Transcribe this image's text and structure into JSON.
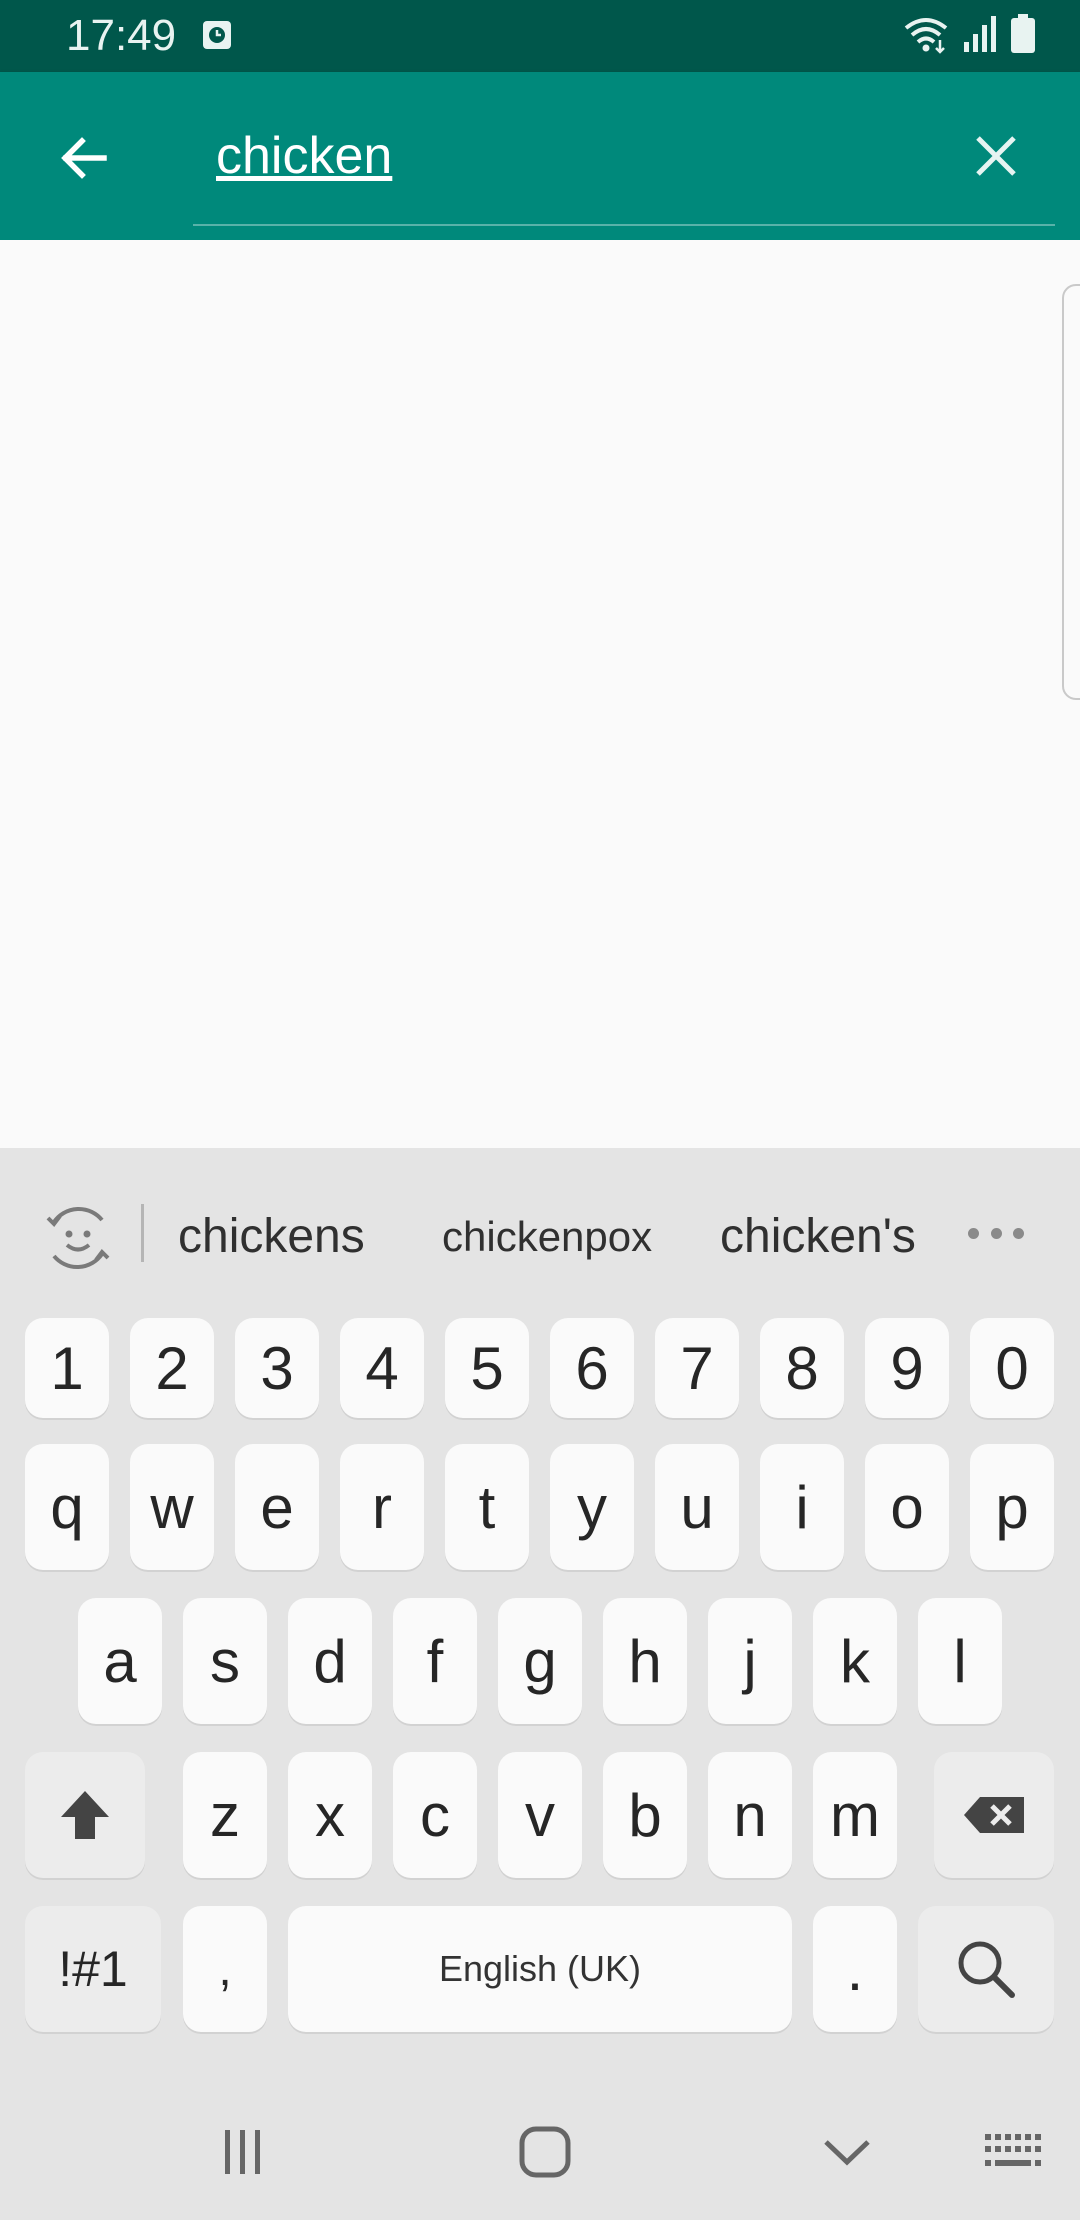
{
  "status_bar": {
    "time": "17:49",
    "icons": [
      "notification-clock-icon",
      "wifi-icon",
      "signal-icon",
      "battery-icon"
    ]
  },
  "app_bar": {
    "search_value": "chicken",
    "icons": [
      "back-arrow-icon",
      "close-icon"
    ],
    "background_color": "#00897b"
  },
  "keyboard": {
    "suggestions": [
      "chickens",
      "chickenpox",
      "chicken's"
    ],
    "number_row": [
      "1",
      "2",
      "3",
      "4",
      "5",
      "6",
      "7",
      "8",
      "9",
      "0"
    ],
    "row1": [
      "q",
      "w",
      "e",
      "r",
      "t",
      "y",
      "u",
      "i",
      "o",
      "p"
    ],
    "row2": [
      "a",
      "s",
      "d",
      "f",
      "g",
      "h",
      "j",
      "k",
      "l"
    ],
    "row3": [
      "z",
      "x",
      "c",
      "v",
      "b",
      "n",
      "m"
    ],
    "symbols_label": "!#1",
    "comma_label": ",",
    "space_label": "English (UK)",
    "period_label": ".",
    "icons": [
      "emoji-icon",
      "more-dots-icon",
      "shift-icon",
      "backspace-icon",
      "search-icon"
    ]
  },
  "nav_bar": {
    "icons": [
      "recents-icon",
      "home-icon",
      "hide-keyboard-icon",
      "keyboard-switch-icon"
    ]
  }
}
